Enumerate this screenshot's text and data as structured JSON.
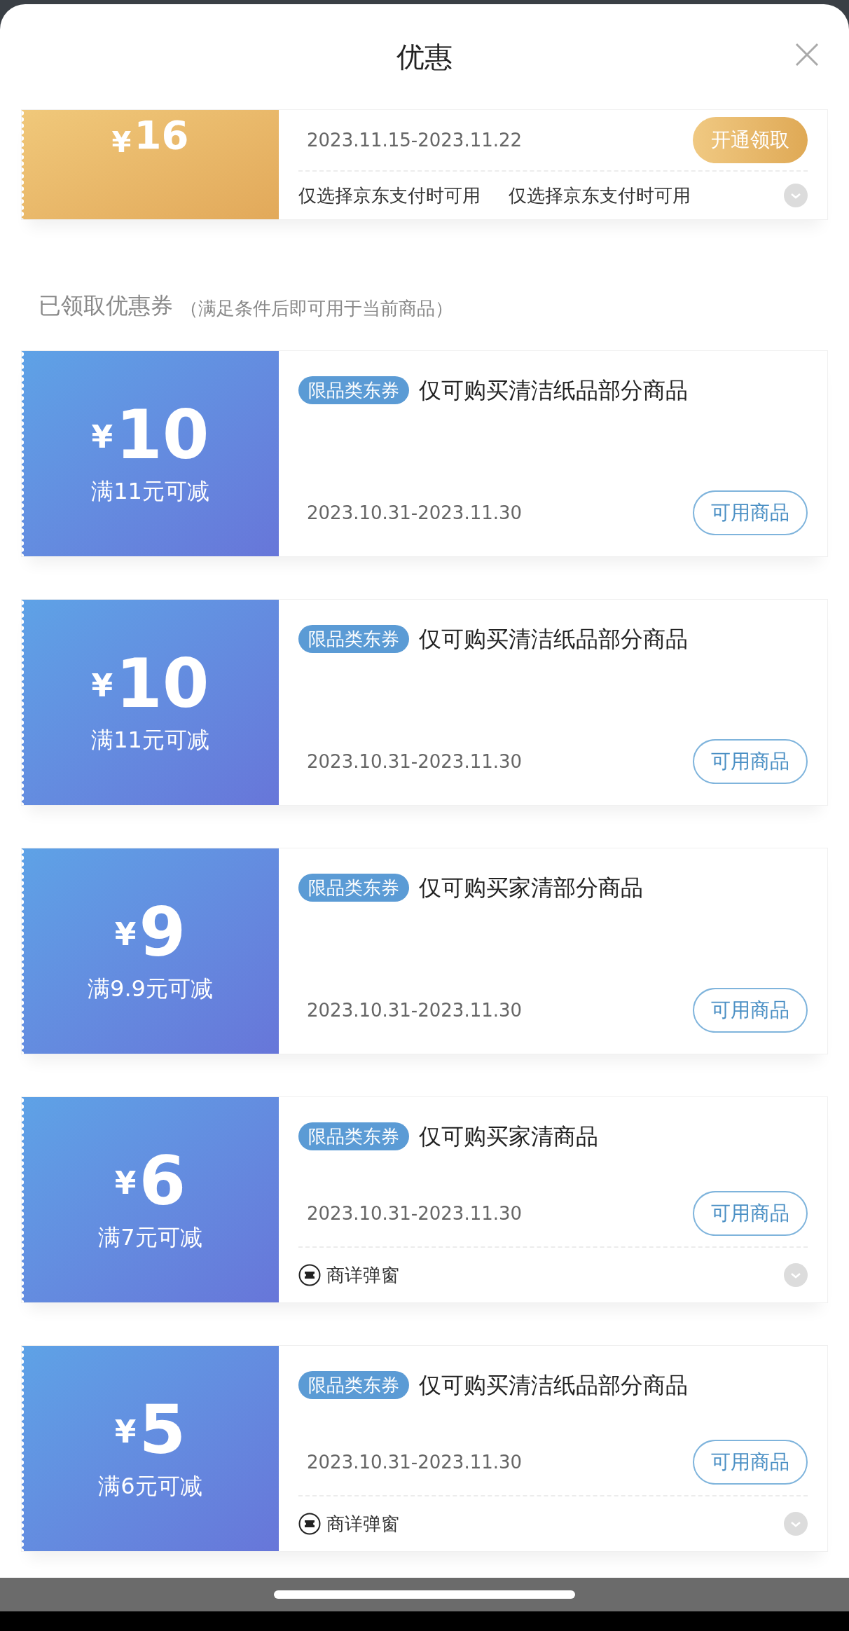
{
  "header": {
    "title": "优惠"
  },
  "top_coupon": {
    "currency": "¥",
    "amount": "16",
    "date_range": "2023.11.15-2023.11.22",
    "action": "开通领取",
    "notes": [
      "仅选择京东支付时可用",
      "仅选择京东支付时可用"
    ]
  },
  "section": {
    "title": "已领取优惠券",
    "subtitle": "（满足条件后即可用于当前商品）"
  },
  "coupons": [
    {
      "currency": "¥",
      "amount": "10",
      "condition": "满11元可减",
      "tag": "限品类东券",
      "title": "仅可购买清洁纸品部分商品",
      "date_range": "2023.10.31-2023.11.30",
      "action": "可用商品"
    },
    {
      "currency": "¥",
      "amount": "10",
      "condition": "满11元可减",
      "tag": "限品类东券",
      "title": "仅可购买清洁纸品部分商品",
      "date_range": "2023.10.31-2023.11.30",
      "action": "可用商品"
    },
    {
      "currency": "¥",
      "amount": "9",
      "condition": "满9.9元可减",
      "tag": "限品类东券",
      "title": "仅可购买家清部分商品",
      "date_range": "2023.10.31-2023.11.30",
      "action": "可用商品"
    },
    {
      "currency": "¥",
      "amount": "6",
      "condition": "满7元可减",
      "tag": "限品类东券",
      "title": "仅可购买家清商品",
      "date_range": "2023.10.31-2023.11.30",
      "action": "可用商品",
      "footer": "商详弹窗"
    },
    {
      "currency": "¥",
      "amount": "5",
      "condition": "满6元可减",
      "tag": "限品类东券",
      "title": "仅可购买清洁纸品部分商品",
      "date_range": "2023.10.31-2023.11.30",
      "action": "可用商品",
      "footer": "商详弹窗"
    }
  ]
}
